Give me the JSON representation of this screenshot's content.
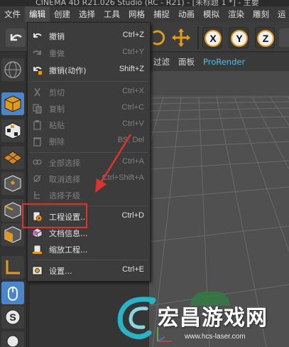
{
  "window": {
    "title_fragment": "CINEMA 4D R21.026 Studio (RC - R21) - [未标题 1 *] - 主要"
  },
  "menubar": {
    "items": [
      {
        "label": "文件",
        "active": false
      },
      {
        "label": "编辑",
        "active": true
      },
      {
        "label": "创建",
        "active": false
      },
      {
        "label": "选择",
        "active": false
      },
      {
        "label": "工具",
        "active": false
      },
      {
        "label": "网格",
        "active": false
      },
      {
        "label": "捕捉",
        "active": false
      },
      {
        "label": "动画",
        "active": false
      },
      {
        "label": "模拟",
        "active": false
      },
      {
        "label": "渲染",
        "active": false
      },
      {
        "label": "雕刻",
        "active": false
      },
      {
        "label": "运",
        "active": false
      }
    ]
  },
  "toolbar": {
    "axis_buttons": [
      {
        "label": "X"
      },
      {
        "label": "Y"
      },
      {
        "label": "Z"
      }
    ]
  },
  "viewport_header": {
    "items": [
      {
        "label": "过滤",
        "accent": false
      },
      {
        "label": "面板",
        "accent": false
      },
      {
        "label": "ProRender",
        "accent": true
      }
    ]
  },
  "edit_menu": {
    "groups": [
      [
        {
          "label": "撤销",
          "shortcut": "Ctrl+Z",
          "enabled": true,
          "icon": "undo-icon"
        },
        {
          "label": "重做",
          "shortcut": "Ctrl+Y",
          "enabled": false,
          "icon": "redo-icon"
        },
        {
          "label": "撤销(动作)",
          "shortcut": "Shift+Z",
          "enabled": true,
          "icon": "undo-action-icon"
        }
      ],
      [
        {
          "label": "剪切",
          "shortcut": "Ctrl+X",
          "enabled": false,
          "icon": "cut-icon"
        },
        {
          "label": "复制",
          "shortcut": "Ctrl+C",
          "enabled": false,
          "icon": "copy-icon"
        },
        {
          "label": "粘贴",
          "shortcut": "Ctrl+V",
          "enabled": false,
          "icon": "paste-icon"
        },
        {
          "label": "删除",
          "shortcut": "BS, Del",
          "enabled": false,
          "icon": "delete-icon"
        }
      ],
      [
        {
          "label": "全部选择",
          "shortcut": "Ctrl+A",
          "enabled": false,
          "icon": "select-all-icon"
        },
        {
          "label": "取消选择",
          "shortcut": "Ctrl+Shift+A",
          "enabled": false,
          "icon": "deselect-icon"
        },
        {
          "label": "选择子级",
          "shortcut": "",
          "enabled": false,
          "icon": "select-children-icon"
        }
      ],
      [
        {
          "label": "工程设置...",
          "shortcut": "Ctrl+D",
          "enabled": true,
          "icon": "project-settings-icon"
        },
        {
          "label": "文档信息...",
          "shortcut": "",
          "enabled": true,
          "icon": "document-info-icon"
        },
        {
          "label": "缩放工程...",
          "shortcut": "",
          "enabled": true,
          "icon": "scale-project-icon"
        }
      ],
      [
        {
          "label": "设置...",
          "shortcut": "Ctrl+E",
          "enabled": true,
          "icon": "preferences-icon"
        }
      ]
    ]
  },
  "annotation": {
    "color": "#e0332d",
    "highlighted_item": "工程设置..."
  },
  "watermark": {
    "title": "宏昌游戏网",
    "url": "www.hcs-laser.com"
  },
  "colors": {
    "accent_blue": "#49c1e6",
    "axis_orange": "#e29a1d",
    "tool_active": "#4a86c8"
  }
}
